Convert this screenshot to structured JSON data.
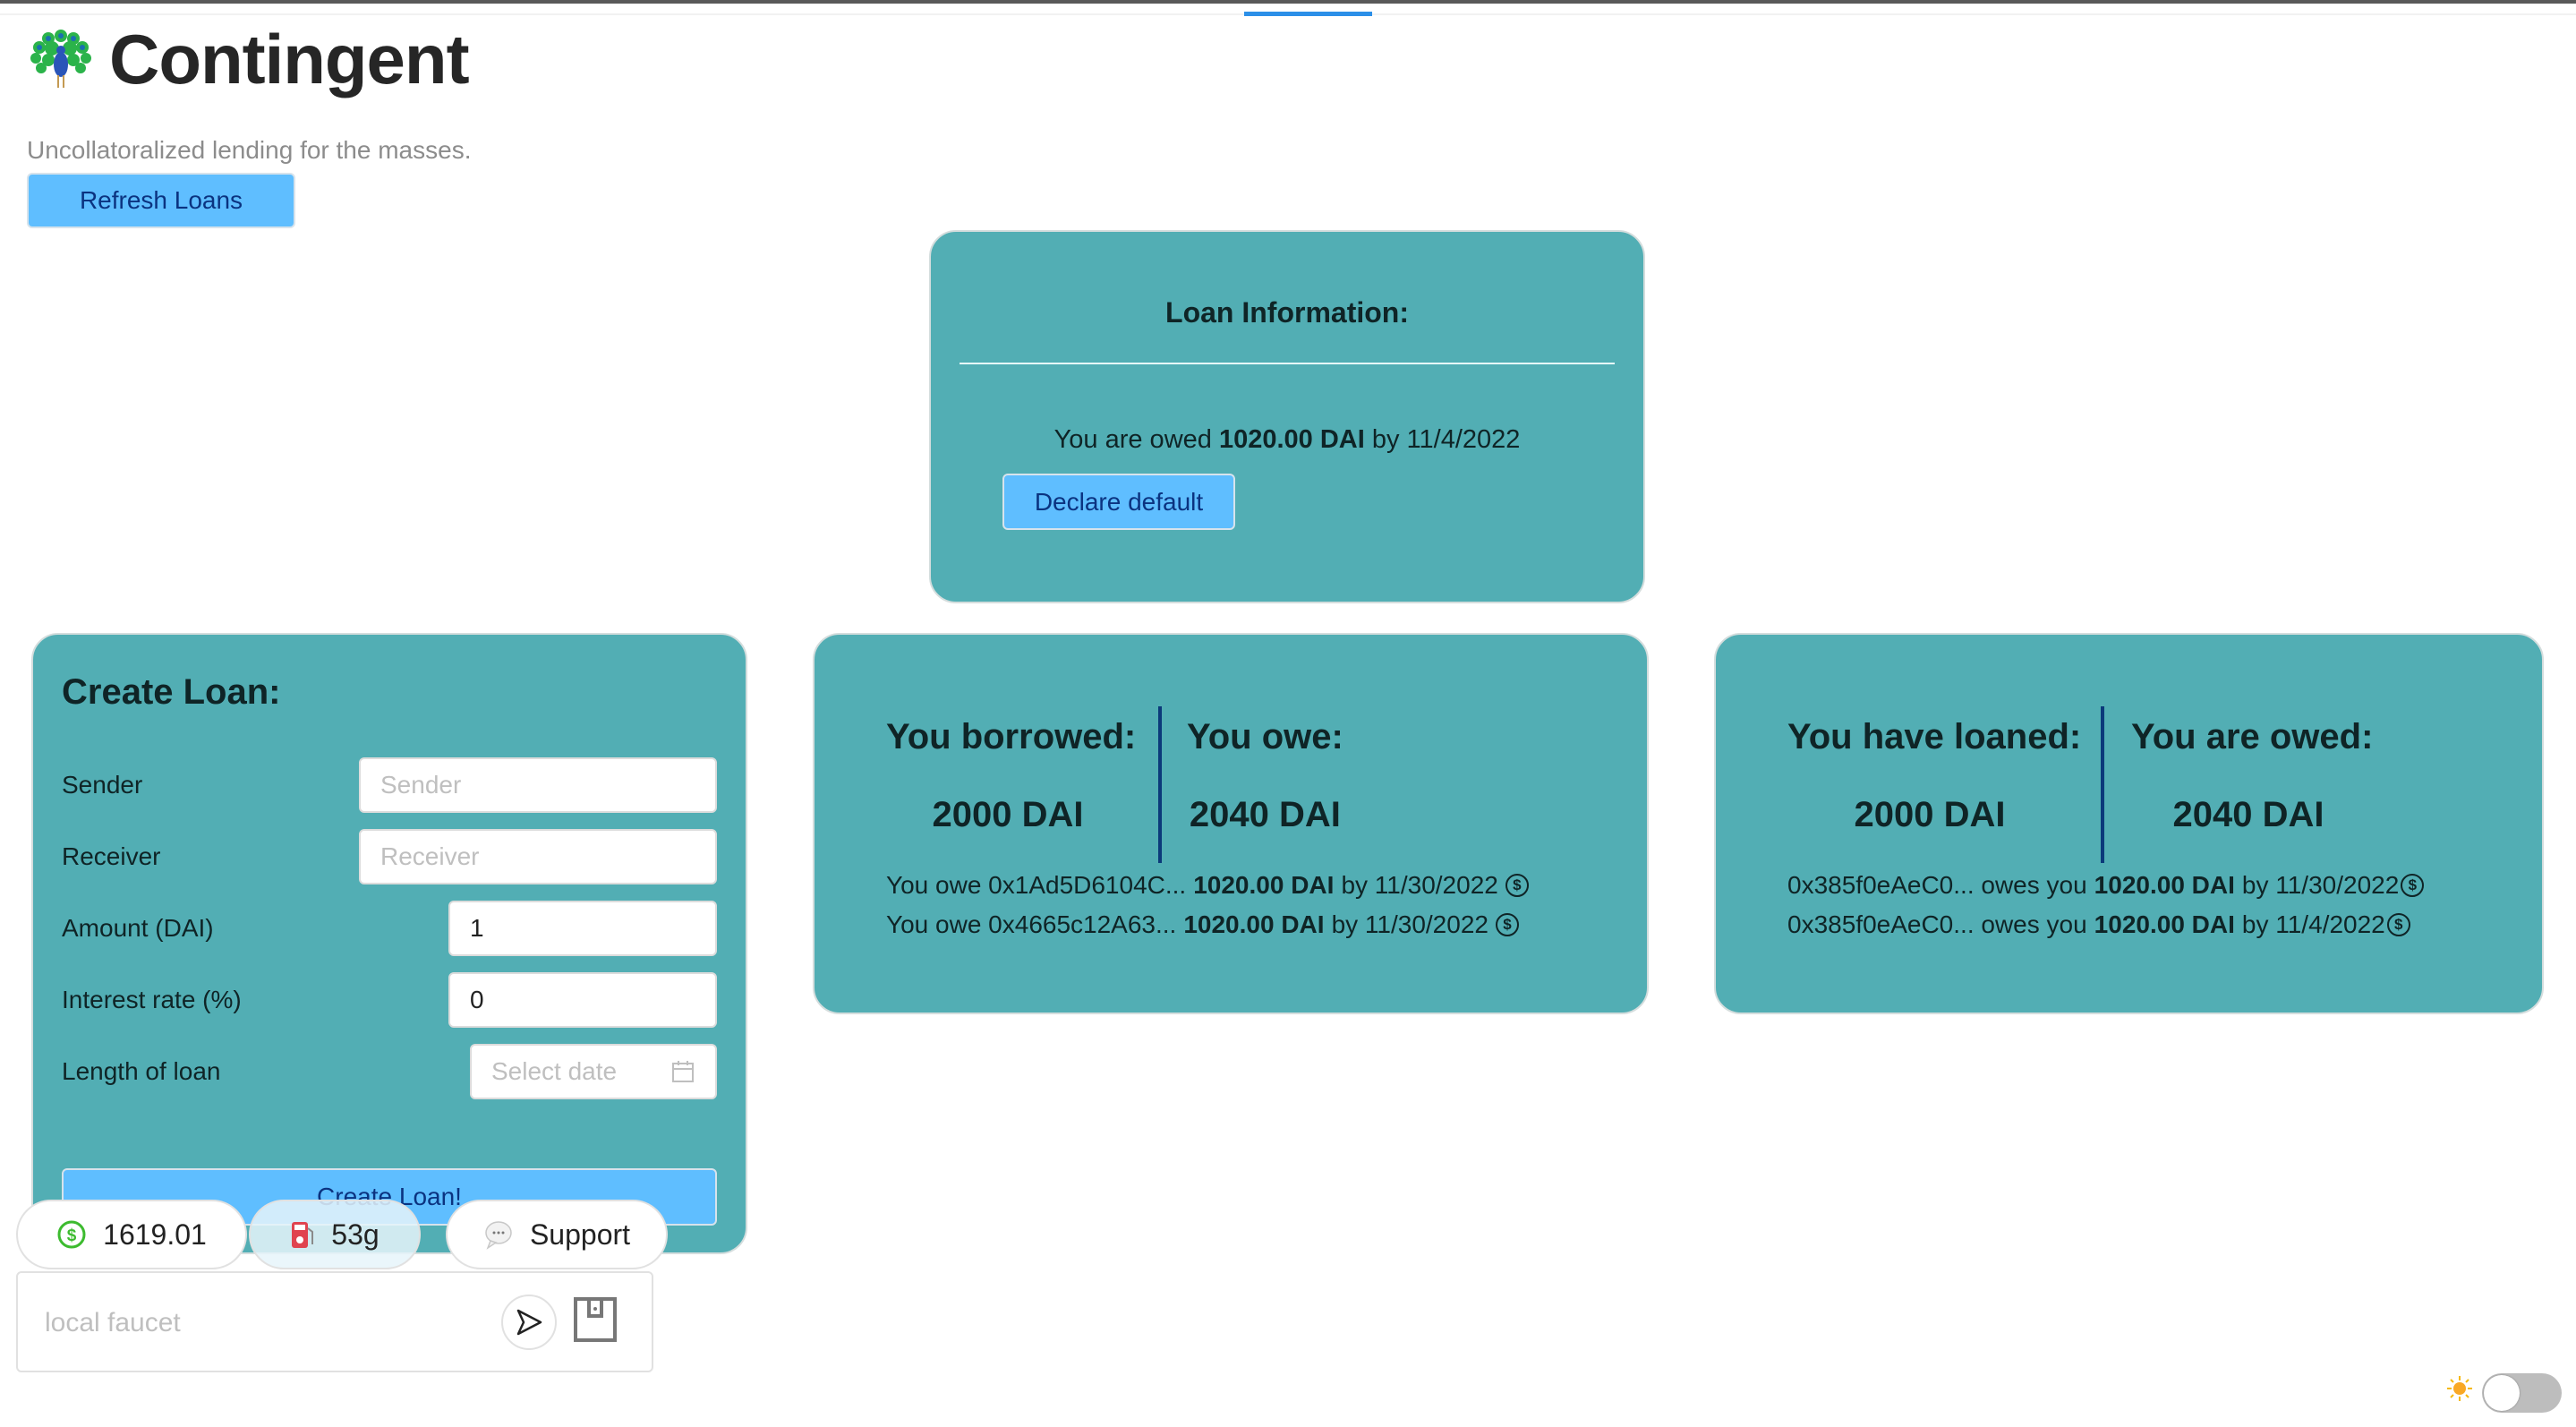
{
  "app": {
    "title": "Contingent",
    "logo_icon": "peacock-emoji",
    "subtitle": "Uncollatoralized lending for the masses.",
    "refresh_label": "Refresh Loans"
  },
  "loan_info": {
    "heading": "Loan Information:",
    "owed_prefix": "You are owed",
    "owed_amount": "1020.00 DAI",
    "owed_by": "by 11/4/2022",
    "declare_default_label": "Declare default"
  },
  "create_loan": {
    "heading": "Create Loan:",
    "fields": [
      {
        "label": "Sender",
        "value": "",
        "placeholder": "Sender"
      },
      {
        "label": "Receiver",
        "value": "",
        "placeholder": "Receiver"
      },
      {
        "label": "Amount (DAI)",
        "value": "1",
        "placeholder": ""
      },
      {
        "label": "Interest rate (%)",
        "value": "0",
        "placeholder": ""
      },
      {
        "label": "Length of loan",
        "value": "",
        "placeholder": "Select date",
        "icon": "calendar-icon"
      }
    ],
    "submit_label": "Create Loan!"
  },
  "borrowed": {
    "left_label": "You borrowed:",
    "left_value": "2000 DAI",
    "right_label": "You owe:",
    "right_value": "2040 DAI",
    "entries": [
      {
        "prefix": "You owe 0x1Ad5D6104C...",
        "amount": "1020.00 DAI",
        "suffix": "by 11/30/2022",
        "icon": "dollar-circle-icon"
      },
      {
        "prefix": "You owe 0x4665c12A63...",
        "amount": "1020.00 DAI",
        "suffix": "by 11/30/2022",
        "icon": "dollar-circle-icon"
      }
    ]
  },
  "loaned": {
    "left_label": "You have loaned:",
    "left_value": "2000 DAI",
    "right_label": "You are owed:",
    "right_value": "2040 DAI",
    "entries": [
      {
        "prefix": "0x385f0eAeC0... owes you",
        "amount": "1020.00 DAI",
        "suffix": "by 11/30/2022",
        "icon": "dollar-circle-icon"
      },
      {
        "prefix": "0x385f0eAeC0... owes you",
        "amount": "1020.00 DAI",
        "suffix": "by 11/4/2022",
        "icon": "dollar-circle-icon"
      }
    ]
  },
  "footer": {
    "balance": "1619.01",
    "gas": "53g",
    "support_label": "Support",
    "faucet_placeholder": "local faucet",
    "faucet_value": "",
    "theme": "light"
  },
  "colors": {
    "card_bg": "#52aeb4",
    "button_bg": "#5fbeff",
    "button_text": "#0b3380",
    "divider": "#0b3a7a",
    "tab_indicator": "#2b8fe8"
  }
}
